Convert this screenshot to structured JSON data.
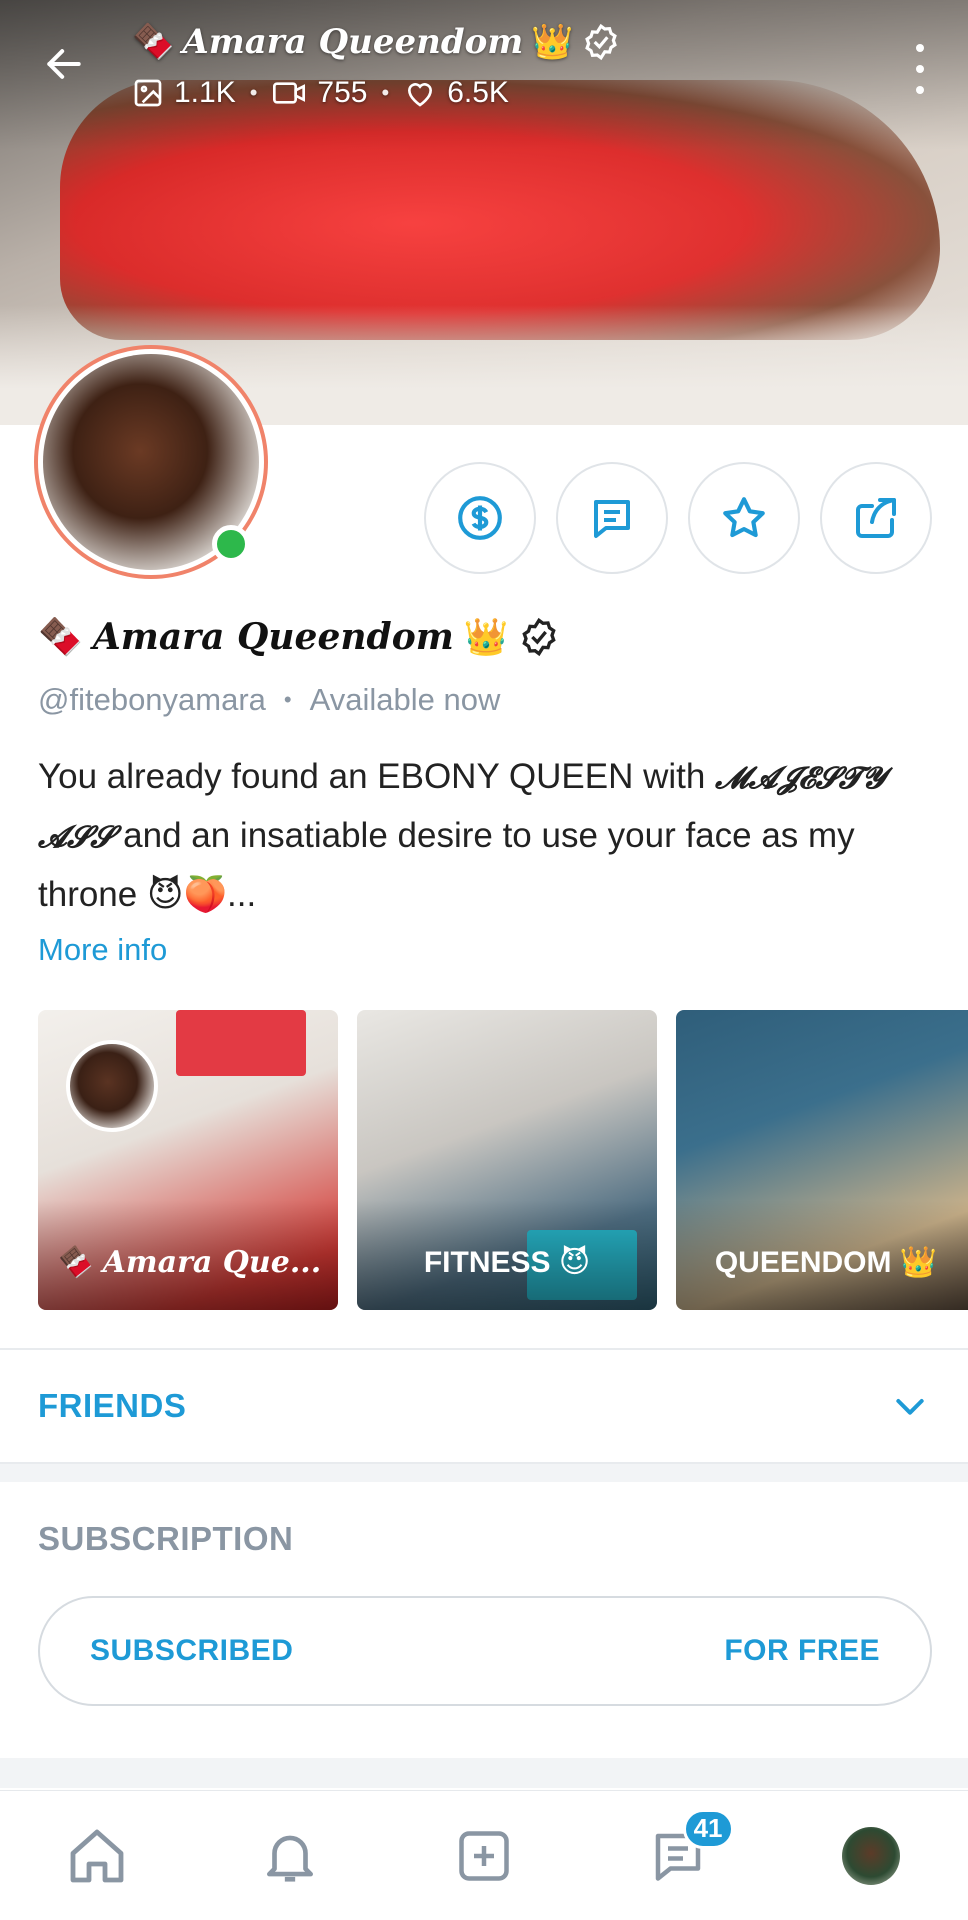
{
  "header": {
    "title": "Amara Queendom",
    "stats": {
      "photos": "1.1K",
      "videos": "755",
      "likes": "6.5K"
    }
  },
  "profile": {
    "name": "Amara Queendom",
    "handle": "@fitebonyamara",
    "status": "Available now",
    "bio_part1": "You already found an EBONY QUEEN with ",
    "bio_fancy": "𝓜𝓐𝓙𝓔𝓢𝓣𝓨 𝓐𝓢𝓢",
    "bio_part2": " and an insatiable desire to use your face as my throne ",
    "bio_emojis": "😈🍑...",
    "more_info": "More info"
  },
  "highlights": [
    {
      "label": "🍫 Amara Que..."
    },
    {
      "label": "FITNESS 😈"
    },
    {
      "label": "QUEENDOM 👑"
    }
  ],
  "friends": {
    "title": "FRIENDS"
  },
  "subscription": {
    "title": "SUBSCRIPTION",
    "status": "SUBSCRIBED",
    "price": "FOR FREE"
  },
  "nav": {
    "messages_badge": "41"
  },
  "colors": {
    "accent": "#1e9ad6",
    "online": "#2db84b",
    "muted": "#8a96a3"
  }
}
